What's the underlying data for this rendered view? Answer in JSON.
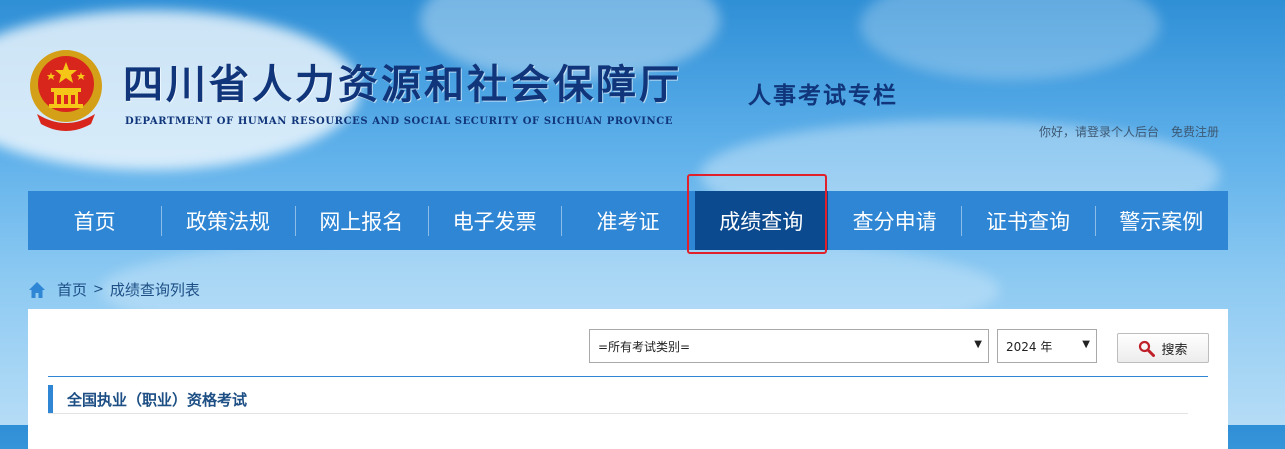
{
  "header": {
    "title": "四川省人力资源和社会保障厅",
    "subtitle": "DEPARTMENT OF HUMAN RESOURCES AND SOCIAL SECURITY OF SICHUAN PROVINCE",
    "column_title": "人事考试专栏",
    "greeting": "你好，请登录个人后台",
    "register": "免费注册",
    "emblem_icon": "national-emblem-icon"
  },
  "nav": {
    "items": [
      "首页",
      "政策法规",
      "网上报名",
      "电子发票",
      "准考证",
      "成绩查询",
      "查分申请",
      "证书查询",
      "警示案例"
    ],
    "active": "成绩查询"
  },
  "breadcrumb": {
    "home": "首页",
    "separator": ">",
    "current": "成绩查询列表"
  },
  "filters": {
    "category": "=所有考试类别=",
    "year": "2024 年",
    "search_label": "搜索"
  },
  "section": {
    "title": "全国执业（职业）资格考试"
  },
  "colors": {
    "nav_bg": "#2f86d4",
    "nav_active": "#0c4a8f",
    "title_blue": "#10357a",
    "highlight": "#e0202a"
  }
}
